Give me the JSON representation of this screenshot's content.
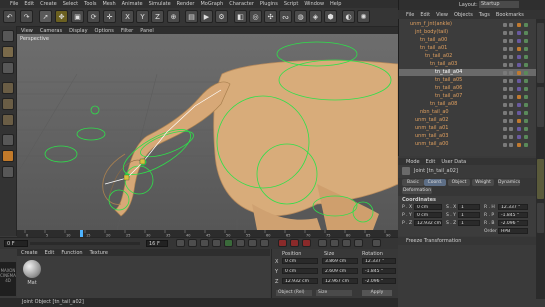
{
  "menubar": {
    "items": [
      "File",
      "Edit",
      "Create",
      "Select",
      "Tools",
      "Mesh",
      "Animate",
      "Simulate",
      "Render",
      "MoGraph",
      "Character",
      "Plugins",
      "Script",
      "Window",
      "Help"
    ]
  },
  "layout_label": "Layout:",
  "layout_value": "Startup",
  "viewport": {
    "menu": [
      "View",
      "Cameras",
      "Display",
      "Options",
      "Filter",
      "Panel"
    ],
    "label": "Perspective"
  },
  "timeline": {
    "start_frame": "0 F",
    "current_frame": "16 F",
    "end_frame": "90 F",
    "ticks": [
      "0",
      "5",
      "10",
      "15",
      "20",
      "25",
      "30",
      "35",
      "40",
      "45",
      "50",
      "55",
      "60",
      "65",
      "70",
      "75",
      "80",
      "85",
      "90"
    ]
  },
  "material": {
    "menu": [
      "Create",
      "Edit",
      "Function",
      "Texture"
    ],
    "swatch_name": "Mat"
  },
  "coordinates_panel": {
    "headers": [
      "Position",
      "Size",
      "Rotation"
    ],
    "rows": [
      {
        "axis": "X",
        "pos": "0 cm",
        "size": "3.869 cm",
        "rot": "12.337 °"
      },
      {
        "axis": "Y",
        "pos": "0 cm",
        "size": "2.609 cm",
        "rot": "-1.845 °"
      },
      {
        "axis": "Z",
        "pos": "12.932 cm",
        "size": "12.967 cm",
        "rot": "-2.096 °"
      }
    ],
    "mode_select": "Object (Rel)",
    "size_select": "Size",
    "apply_label": "Apply"
  },
  "statusbar": {
    "text": "Joint Object [tn_tail_a02]"
  },
  "maxon": {
    "line1": "MAXON",
    "line2": "CINEMA 4D"
  },
  "object_manager": {
    "menu": [
      "File",
      "Edit",
      "View",
      "Objects",
      "Tags",
      "Bookmarks"
    ],
    "rows": [
      {
        "name": "unm_f_jnt(ankle)",
        "indent": 1,
        "selected": false
      },
      {
        "name": "jnt_body(tail)",
        "indent": 2,
        "selected": false
      },
      {
        "name": "tn_tail_a00",
        "indent": 3,
        "selected": false
      },
      {
        "name": "tn_tail_a01",
        "indent": 3,
        "selected": false
      },
      {
        "name": "tn_tail_a02",
        "indent": 4,
        "selected": false
      },
      {
        "name": "tn_tail_a03",
        "indent": 5,
        "selected": false
      },
      {
        "name": "tn_tail_a04",
        "indent": 6,
        "selected": true
      },
      {
        "name": "tn_tail_a05",
        "indent": 6,
        "selected": false
      },
      {
        "name": "tn_tail_a06",
        "indent": 6,
        "selected": false
      },
      {
        "name": "tn_tail_a07",
        "indent": 6,
        "selected": false
      },
      {
        "name": "tn_tail_a08",
        "indent": 5,
        "selected": false
      },
      {
        "name": "nbn_tail_a0",
        "indent": 3,
        "selected": false
      },
      {
        "name": "unm_tail_a02",
        "indent": 2,
        "selected": false
      },
      {
        "name": "unm_tail_a01",
        "indent": 2,
        "selected": false
      },
      {
        "name": "unm_tail_a03",
        "indent": 2,
        "selected": false
      },
      {
        "name": "unm_tail_a00",
        "indent": 2,
        "selected": false
      }
    ]
  },
  "attribute_manager": {
    "menu": [
      "Mode",
      "Edit",
      "User Data"
    ],
    "title": "Joint [tn_tail_a02]",
    "tabs": [
      "Basic",
      "Coord.",
      "Object",
      "Weight",
      "Dynamics",
      "Deformation"
    ],
    "active_tab": "Coord.",
    "section": "Coordinates",
    "rows": [
      {
        "p_label": "P . X",
        "p_val": "0 cm",
        "s_label": "S . X",
        "s_val": "1",
        "r_label": "R . H",
        "r_val": "12.337 °"
      },
      {
        "p_label": "P . Y",
        "p_val": "0 cm",
        "s_label": "S . Y",
        "s_val": "1",
        "r_label": "R . P",
        "r_val": "-1.845 °"
      },
      {
        "p_label": "P . Z",
        "p_val": "12.932 cm",
        "s_label": "S . Z",
        "s_val": "1",
        "r_label": "R . B",
        "r_val": "-2.096 °"
      }
    ],
    "order_label": "Order",
    "order_value": "HPB",
    "freeze": "Freeze Transformation"
  },
  "side_tabs": [
    "Content Browser",
    "Structure",
    "Attributes",
    "Layers"
  ],
  "colors": {
    "accent_selected": "#5d6e86",
    "joint_green": "#2ee04a",
    "horse_skin": "#d9ad7c",
    "timeline_cursor": "#4db3ff"
  }
}
